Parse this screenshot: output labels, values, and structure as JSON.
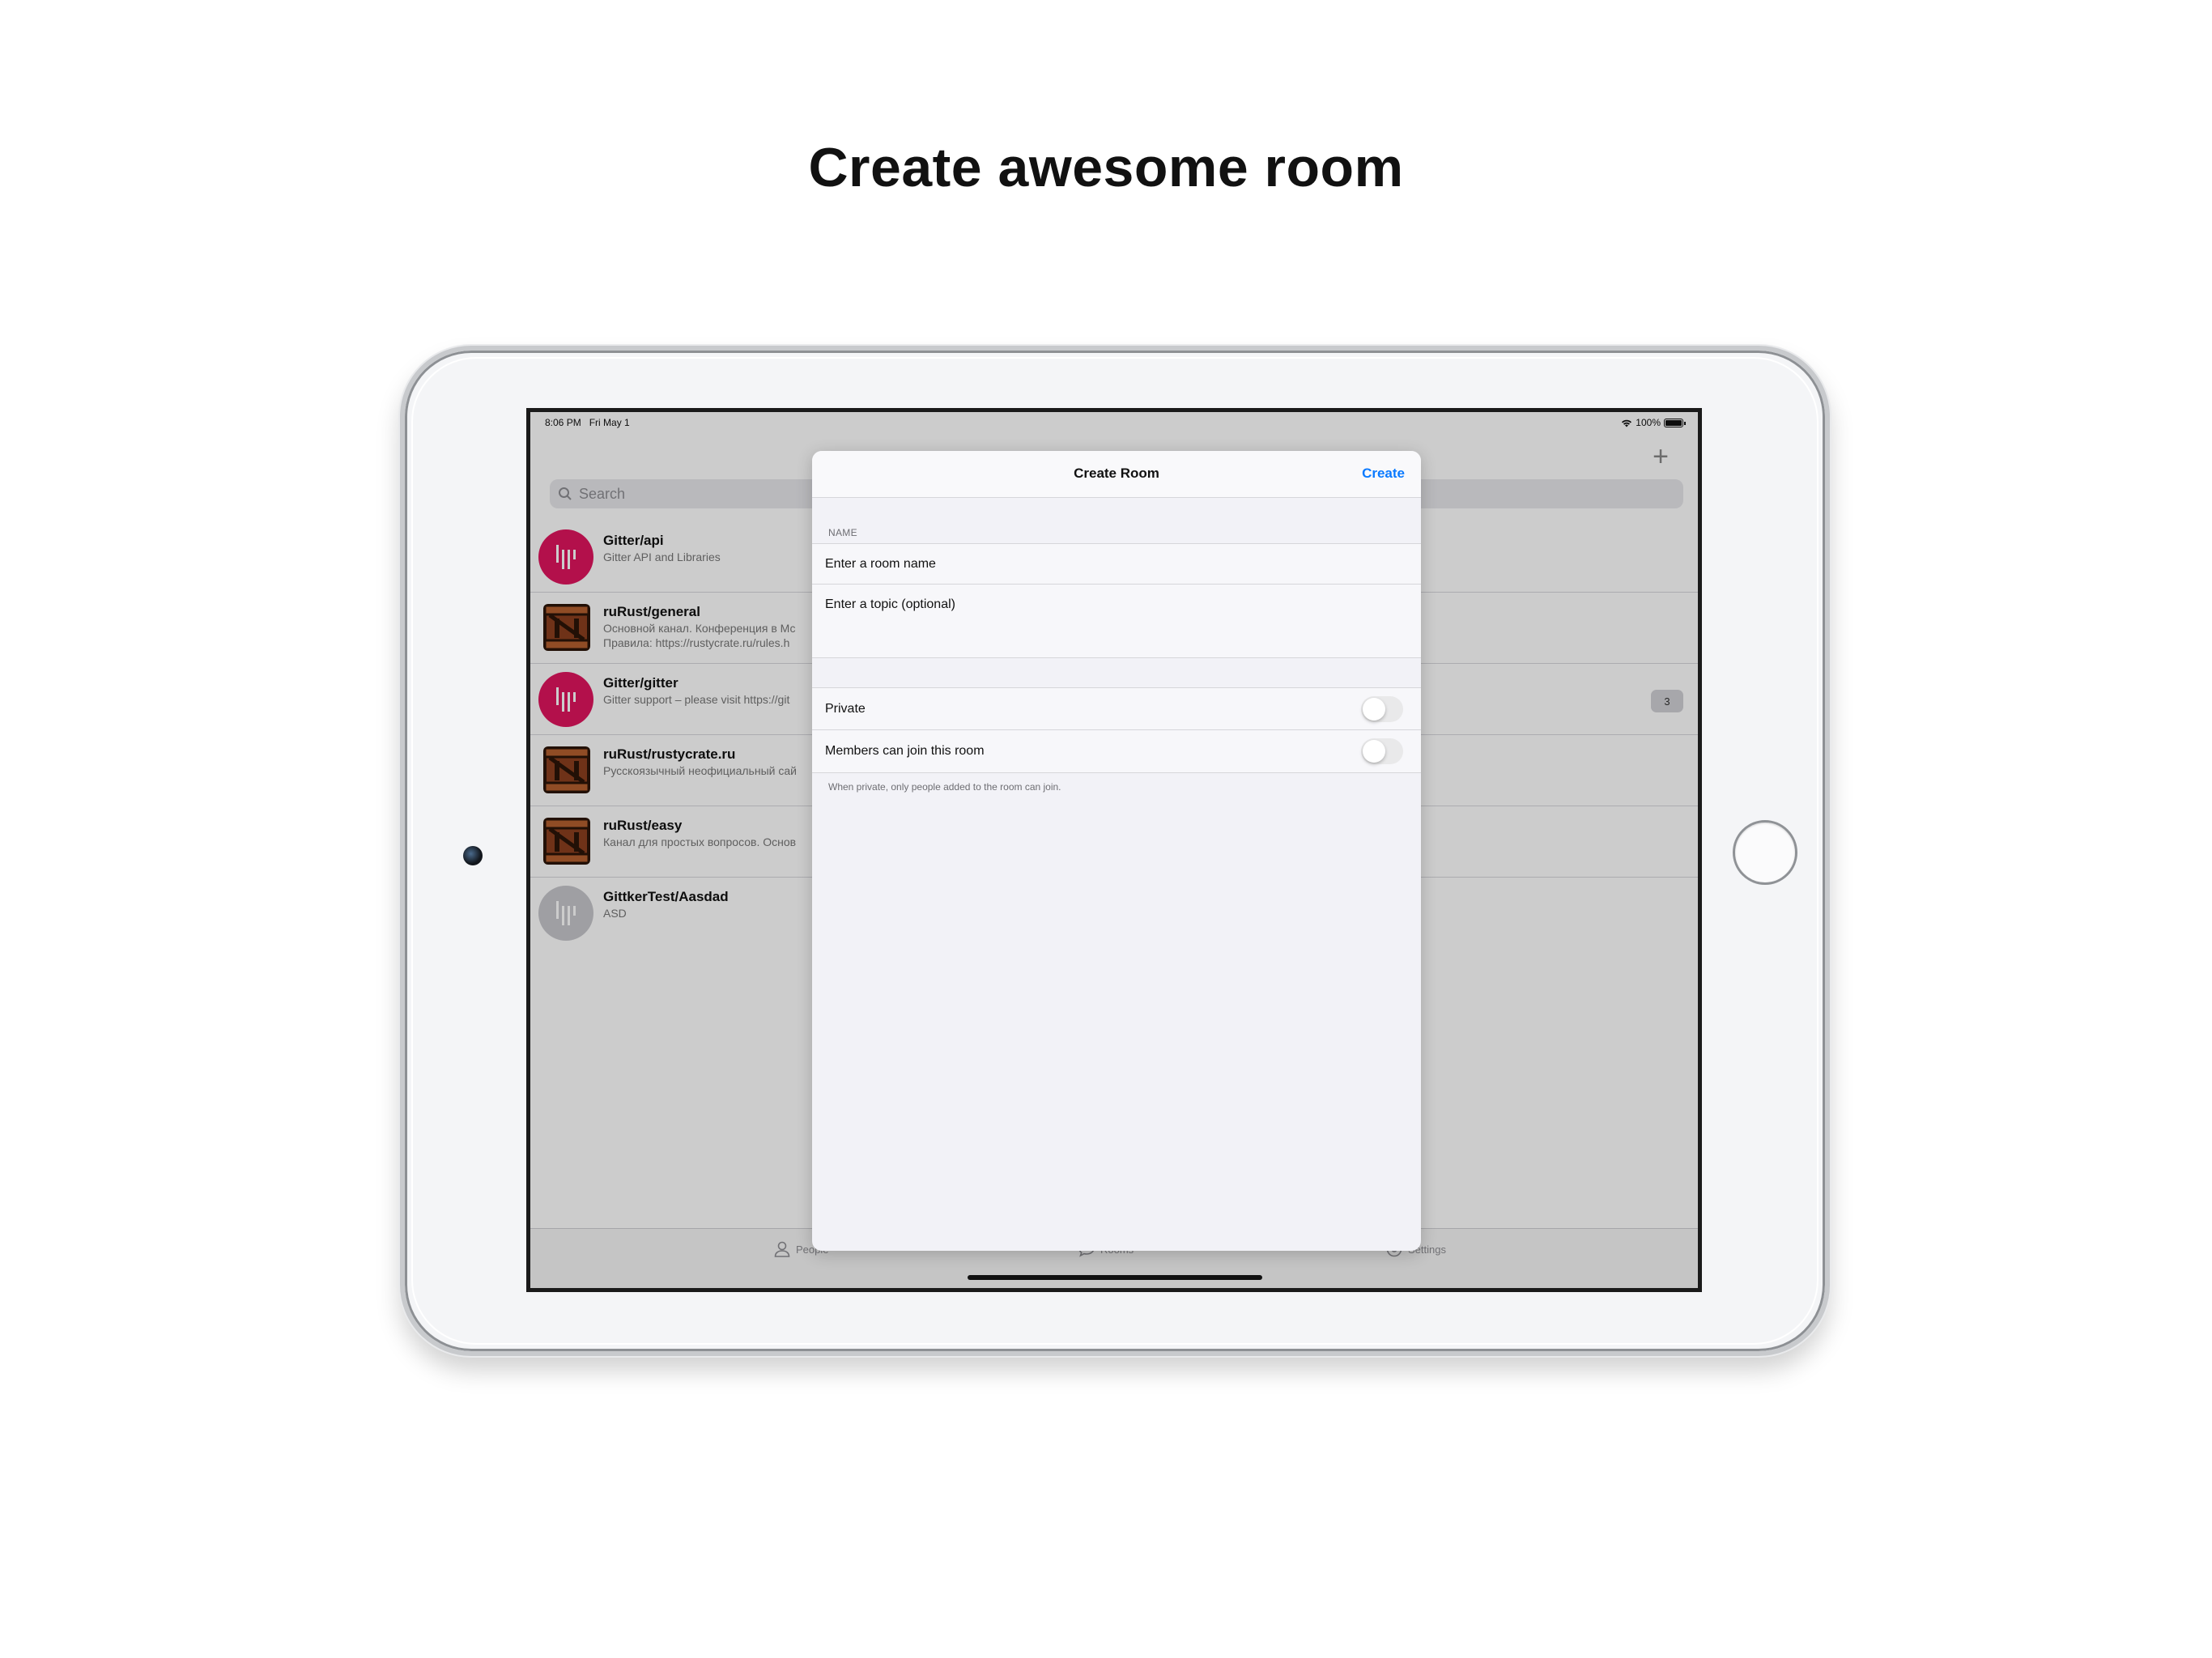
{
  "headline": "Create awesome room",
  "status": {
    "time": "8:06 PM",
    "date": "Fri May 1",
    "battery": "100%"
  },
  "list": {
    "search_placeholder": "Search",
    "add_icon": "plus-icon",
    "rooms": [
      {
        "name": "Gitter/api",
        "sub": "Gitter API and Libraries",
        "avatar": "gitter"
      },
      {
        "name": "ruRust/general",
        "sub": "Основной канал. Конференция в Мс                                                                                 цество: https://www.patreon.com/mkpankov .",
        "sub2": "Правила: https://rustycrate.ru/rules.h                                                                               offtopic . Сайт - http://rustycrate.ru/ . Форум -...",
        "avatar": "crate"
      },
      {
        "name": "Gitter/gitter",
        "sub": "Gitter support – please visit https://git                                                                                     fore chatting",
        "avatar": "gitter",
        "badge": "3"
      },
      {
        "name": "ruRust/rustycrate.ru",
        "sub": "Русскоязычный неофициальный сай",
        "avatar": "crate"
      },
      {
        "name": "ruRust/easy",
        "sub": "Канал для простых вопросов. Основ",
        "avatar": "crate"
      },
      {
        "name": "GittkerTest/Aasdad",
        "sub": "ASD",
        "avatar": "gitter-grey"
      }
    ]
  },
  "tabs": {
    "people": "People",
    "rooms": "Rooms",
    "settings": "Settings"
  },
  "modal": {
    "title": "Create Room",
    "create_label": "Create",
    "section_name": "NAME",
    "name_placeholder": "Enter a room name",
    "topic_placeholder": "Enter a topic (optional)",
    "private_label": "Private",
    "members_label": "Members can join this room",
    "footer_note": "When private, only people added to the room can join.",
    "private_on": false,
    "members_on": false
  },
  "colors": {
    "accent": "#0a7aff",
    "gitter": "#e0155e"
  }
}
